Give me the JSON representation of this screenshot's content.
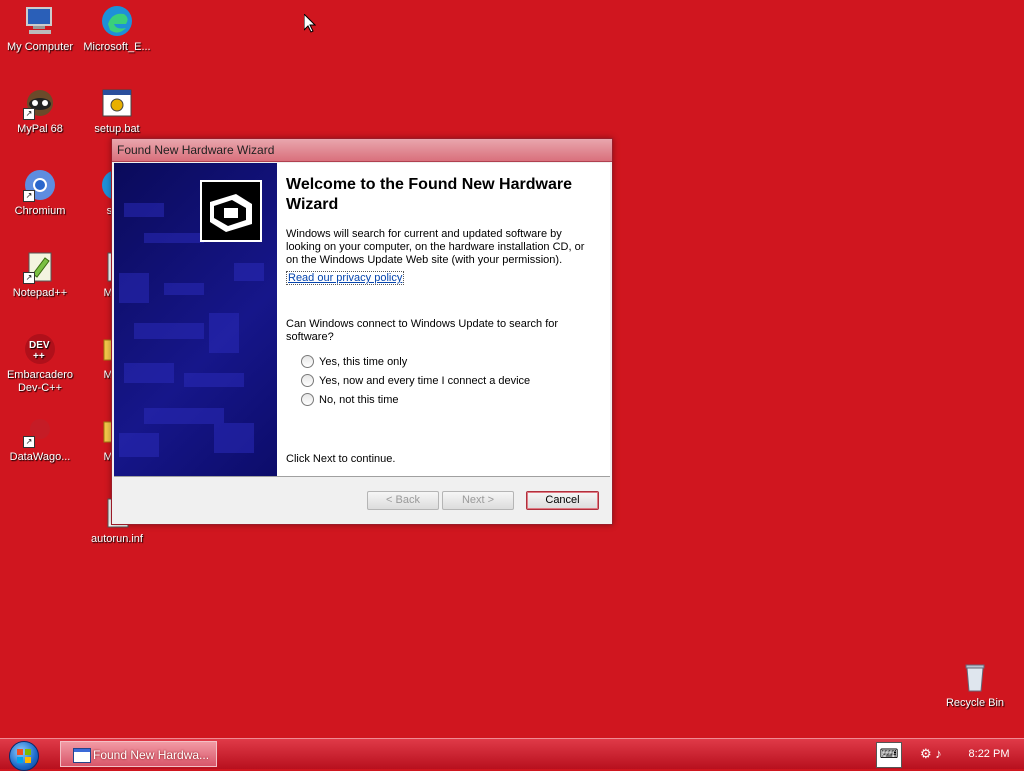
{
  "desktop": {
    "icons": [
      {
        "label": "My Computer"
      },
      {
        "label": "Microsoft_E..."
      },
      {
        "label": "MyPal 68"
      },
      {
        "label": "setup.bat"
      },
      {
        "label": "Chromium"
      },
      {
        "label": "setu"
      },
      {
        "label": "Notepad++"
      },
      {
        "label": "Micro"
      },
      {
        "label": "Embarcadero Dev-C++"
      },
      {
        "label": "Micro"
      },
      {
        "label": "DataWago..."
      },
      {
        "label": "Micro"
      },
      {
        "label": "autorun.inf"
      },
      {
        "label": "Recycle Bin"
      }
    ],
    "background_color": "#d0161f"
  },
  "wizard": {
    "title": "Found New Hardware Wizard",
    "heading": "Welcome to the Found New Hardware Wizard",
    "description": "Windows will search for current and updated software by looking on your computer, on the hardware installation CD, or on the Windows Update Web site (with your permission).",
    "privacy_link": "Read our privacy policy",
    "question": "Can Windows connect to Windows Update to search for software?",
    "options": [
      {
        "label": "Yes, this time only"
      },
      {
        "label": "Yes, now and every time I connect a device"
      },
      {
        "label": "No, not this time"
      }
    ],
    "continue_text": "Click Next to continue.",
    "buttons": {
      "back": "< Back",
      "next": "Next >",
      "cancel": "Cancel"
    }
  },
  "taskbar": {
    "task_label": "Found New Hardwa...",
    "clock": "8:22 PM"
  }
}
